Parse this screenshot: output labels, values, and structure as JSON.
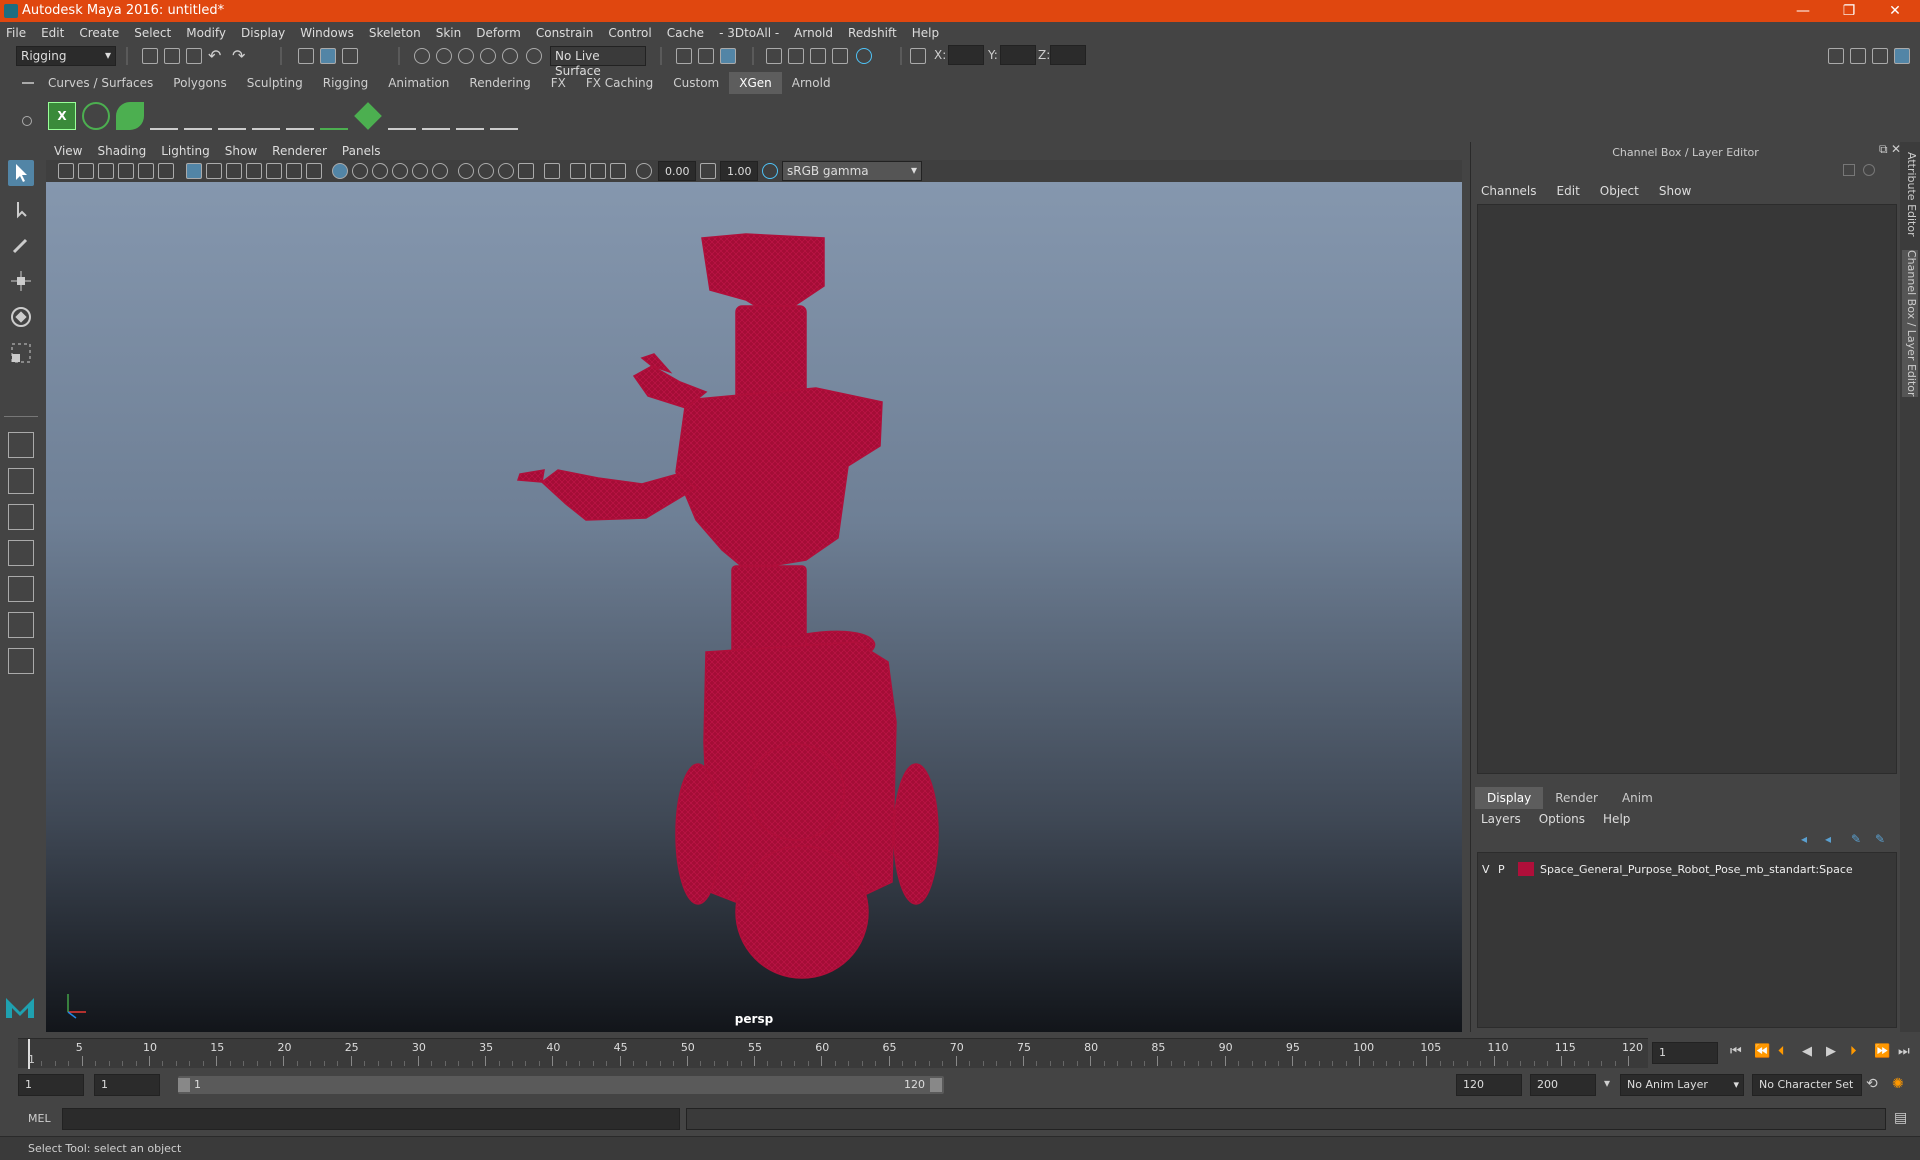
{
  "titlebar": {
    "title": "Autodesk Maya 2016: untitled*",
    "controls": [
      "—",
      "❐",
      "✕"
    ]
  },
  "menubar": {
    "items": [
      "File",
      "Edit",
      "Create",
      "Select",
      "Modify",
      "Display",
      "Windows",
      "Skeleton",
      "Skin",
      "Deform",
      "Constrain",
      "Control",
      "Cache",
      "- 3DtoAll -",
      "Arnold",
      "Redshift",
      "Help"
    ]
  },
  "statusline": {
    "mode": "Rigging",
    "live_surface": "No Live Surface",
    "coord_x_label": "X:",
    "coord_y_label": "Y:",
    "coord_z_label": "Z:"
  },
  "shelf": {
    "tabs": [
      "Curves / Surfaces",
      "Polygons",
      "Sculpting",
      "Rigging",
      "Animation",
      "Rendering",
      "FX",
      "FX Caching",
      "Custom",
      "XGen",
      "Arnold"
    ],
    "active_tab": "XGen"
  },
  "viewport": {
    "menu": [
      "View",
      "Shading",
      "Lighting",
      "Show",
      "Renderer",
      "Panels"
    ],
    "exposure": "0.00",
    "gamma": "1.00",
    "color_space": "sRGB gamma",
    "camera_label": "persp",
    "wire_color": "#b00f3a"
  },
  "channelbox": {
    "title": "Channel Box / Layer Editor",
    "menu": [
      "Channels",
      "Edit",
      "Object",
      "Show"
    ],
    "layer_tabs": [
      "Display",
      "Render",
      "Anim"
    ],
    "active_layer_tab": "Display",
    "layer_menu": [
      "Layers",
      "Options",
      "Help"
    ],
    "layer": {
      "visible": "V",
      "playback": "P",
      "name": "Space_General_Purpose_Robot_Pose_mb_standart:Space",
      "color": "#b00f3a"
    }
  },
  "sidetabs": {
    "attribute_editor": "Attribute Editor",
    "channel_box": "Channel Box / Layer Editor"
  },
  "timeslider": {
    "ticks": [
      "5",
      "10",
      "15",
      "20",
      "25",
      "30",
      "35",
      "40",
      "45",
      "50",
      "55",
      "60",
      "65",
      "70",
      "75",
      "80",
      "85",
      "90",
      "95",
      "100",
      "105",
      "110",
      "115",
      "120"
    ],
    "current_frame": "1",
    "current_frame_field": "1"
  },
  "range": {
    "start": "1",
    "playback_start": "1",
    "slider_start": "1",
    "slider_end": "120",
    "playback_end": "120",
    "end": "200",
    "anim_layer": "No Anim Layer",
    "character_set": "No Character Set"
  },
  "mel": {
    "label": "MEL"
  },
  "status": {
    "help_line": "Select Tool: select an object"
  }
}
